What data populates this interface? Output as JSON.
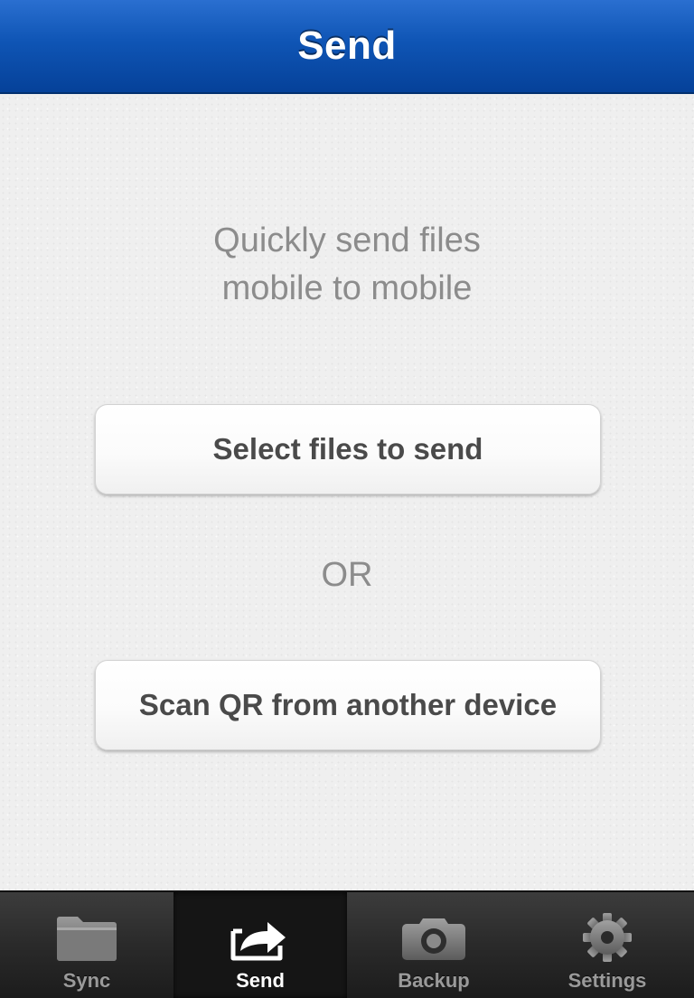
{
  "navbar": {
    "title": "Send"
  },
  "main": {
    "tagline_line1": "Quickly send files",
    "tagline_line2": "mobile to mobile",
    "select_files_label": "Select files to send",
    "or_label": "OR",
    "scan_qr_label": "Scan QR from another device"
  },
  "tabbar": {
    "active_tab": "Send",
    "tabs": [
      {
        "label": "Sync",
        "icon": "folder-icon"
      },
      {
        "label": "Send",
        "icon": "share-arrow-icon"
      },
      {
        "label": "Backup",
        "icon": "camera-icon"
      },
      {
        "label": "Settings",
        "icon": "gear-icon"
      }
    ]
  },
  "colors": {
    "navbar_blue": "#0f55b5",
    "tagline_gray": "#8c8c8c",
    "button_text": "#4a4a4a",
    "tab_active_label": "#ffffff",
    "tab_inactive_label": "#9a9a9a"
  }
}
